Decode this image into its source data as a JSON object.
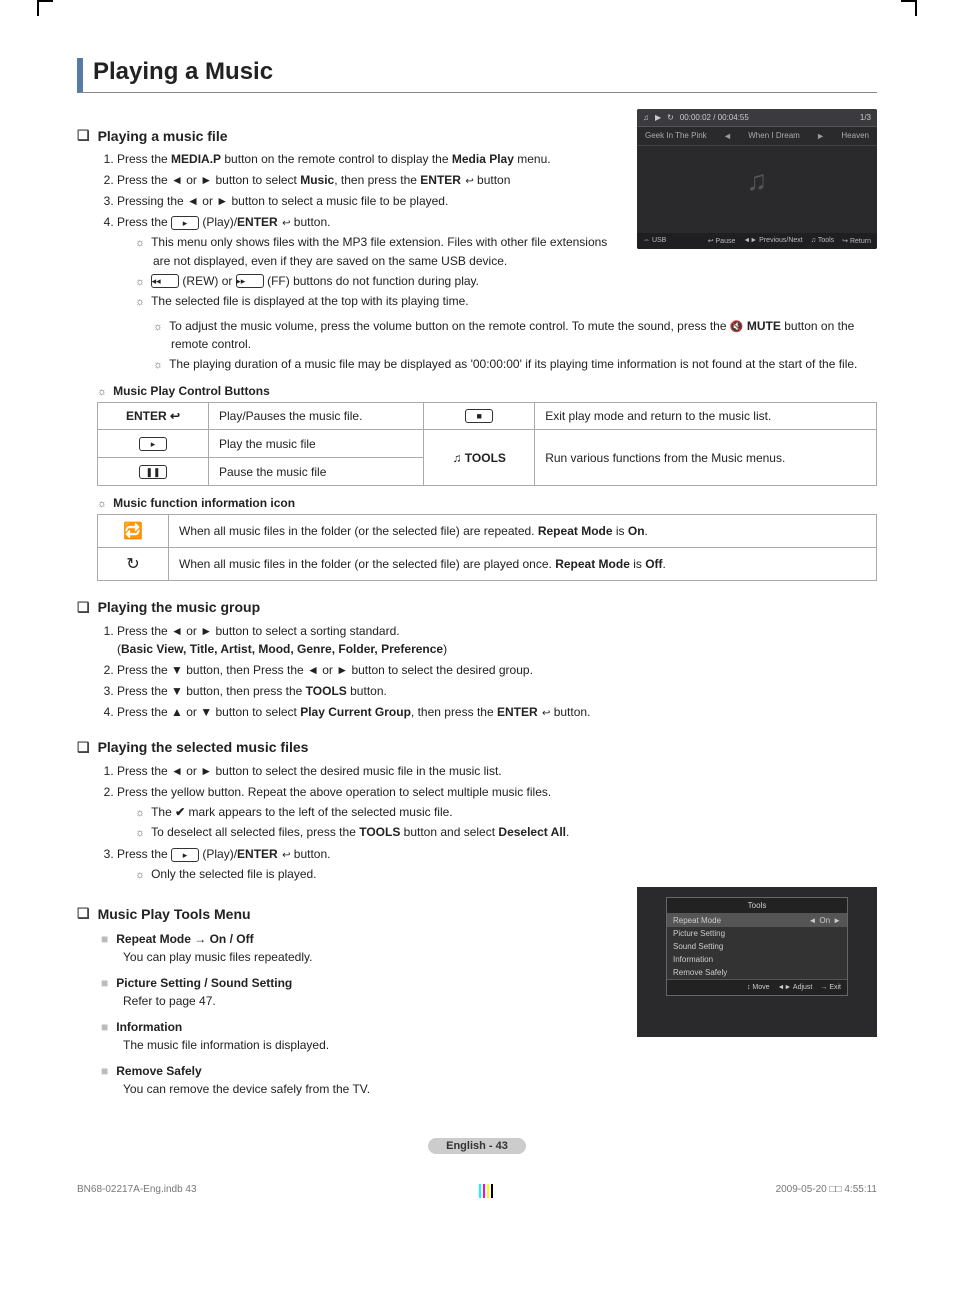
{
  "title": "Playing a Music",
  "s1": {
    "heading": "Playing a music file",
    "steps": [
      "Press the MEDIA.P button on the remote control to display the Media Play menu.",
      "Press the ◄ or ► button to select Music, then press the ENTER ↩ button",
      "Pressing the ◄ or ► button to select a music file to be played.",
      "Press the ▶ (Play)/ENTER ↩ button."
    ],
    "notes": [
      "This menu only shows files with the MP3 file extension. Files with other file extensions are not displayed, even if they are saved on the same USB device.",
      "◄◄ (REW) or ►► (FF) buttons do not function during play.",
      "The selected file is displayed at the top with its playing time.",
      "To adjust the music volume, press the volume button on the remote control. To mute the sound, press the 🔇 MUTE button on the remote control.",
      "The playing duration of a music file may be displayed as '00:00:00' if its playing time information is not found at the start of the file."
    ]
  },
  "ctrl_heading": "Music Play Control Buttons",
  "ctrl": {
    "enter_label": "ENTER ↩",
    "enter_desc": "Play/Pauses the music file.",
    "play_desc": "Play the music file",
    "pause_desc": "Pause the music file",
    "stop_desc": "Exit play mode and return to the music list.",
    "tools_label": "♫ TOOLS",
    "tools_desc": "Run various functions from the Music menus."
  },
  "icon_heading": "Music function information icon",
  "icon_tbl": {
    "repeat_on": "When all music files in the folder (or the selected file) are repeated. Repeat Mode is On.",
    "repeat_off": "When all music files in the folder (or the selected file) are played once. Repeat Mode is Off."
  },
  "s2": {
    "heading": "Playing the music group",
    "steps": [
      "Press the ◄ or ► button to select a sorting standard.\n(Basic View, Title, Artist, Mood, Genre, Folder, Preference)",
      "Press the ▼ button, then Press the ◄ or ► button to select the desired group.",
      "Press the ▼ button, then press the TOOLS button.",
      "Press the ▲ or ▼ button to select Play Current Group, then press the ENTER ↩ button."
    ]
  },
  "s3": {
    "heading": "Playing the selected music files",
    "step1": "Press the ◄ or ► button to select the desired music file in the music list.",
    "step2": "Press the yellow button. Repeat the above operation to select multiple music files.",
    "step2_n1": "The ✔ mark appears to the left of the selected music file.",
    "step2_n2": "To deselect all selected files, press the TOOLS button and select Deselect All.",
    "step3": "Press the ▶ (Play)/ENTER ↩ button.",
    "step3_n1": "Only the selected file is played."
  },
  "s4": {
    "heading": "Music Play Tools Menu",
    "items": [
      {
        "hd": "Repeat Mode → On / Off",
        "desc": "You can play music files repeatedly."
      },
      {
        "hd": "Picture Setting / Sound Setting",
        "desc": "Refer to page 47."
      },
      {
        "hd": "Information",
        "desc": "The music file information is displayed."
      },
      {
        "hd": "Remove Safely",
        "desc": "You can remove the device safely from the TV."
      }
    ]
  },
  "player": {
    "time": "00:00:02 / 00:04:55",
    "counter": "1/3",
    "track_left": "Geek In The Pink",
    "track_mid": "When I Dream",
    "track_right": "Heaven",
    "usb": "USB",
    "f1": "↩ Pause",
    "f2": "◄► Previous/Next",
    "f3": "♫ Tools",
    "f4": "↪ Return"
  },
  "tools_popup": {
    "title": "Tools",
    "rows": [
      "Repeat Mode",
      "Picture Setting",
      "Sound Setting",
      "Information",
      "Remove Safely"
    ],
    "on": "On",
    "ft_move": "↕ Move",
    "ft_adjust": "◄► Adjust",
    "ft_exit": "→ Exit"
  },
  "page_label": "English - 43",
  "footer_left": "BN68-02217A-Eng.indb   43",
  "footer_right": "2009-05-20   □□ 4:55:11"
}
